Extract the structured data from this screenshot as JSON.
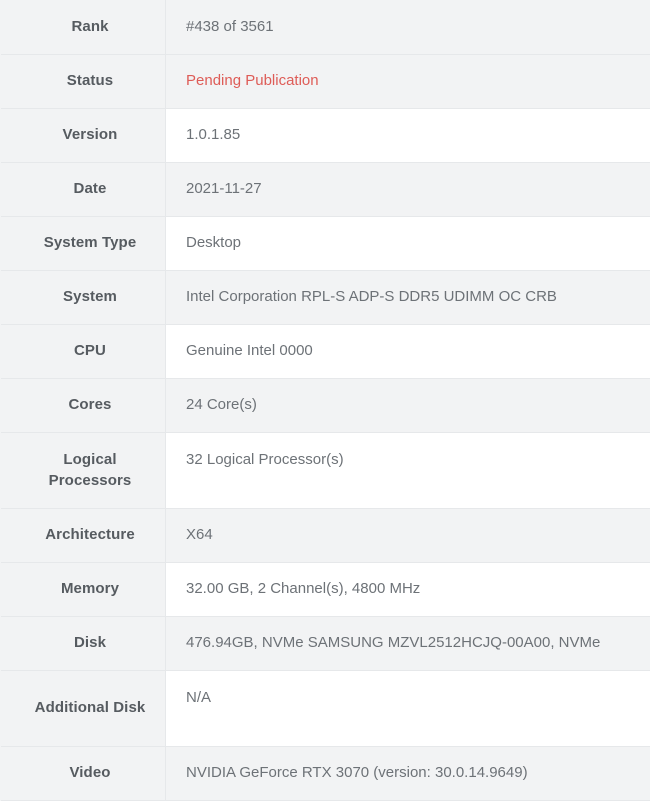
{
  "table": {
    "accent_color": "#de5c57",
    "label_color": "#565b60",
    "value_color": "#6d7277",
    "stripe_color": "#f2f3f4",
    "border_color": "#e6e8ea",
    "rows": [
      {
        "label": "Rank",
        "value": "#438 of 3561"
      },
      {
        "label": "Status",
        "value": "Pending Publication"
      },
      {
        "label": "Version",
        "value": "1.0.1.85"
      },
      {
        "label": "Date",
        "value": "2021-11-27"
      },
      {
        "label": "System Type",
        "value": "Desktop"
      },
      {
        "label": "System",
        "value": "Intel Corporation RPL-S ADP-S DDR5 UDIMM OC CRB"
      },
      {
        "label": "CPU",
        "value": "Genuine Intel 0000"
      },
      {
        "label": "Cores",
        "value": "24 Core(s)"
      },
      {
        "label": "Logical Processors",
        "value": "32 Logical Processor(s)"
      },
      {
        "label": "Architecture",
        "value": "X64"
      },
      {
        "label": "Memory",
        "value": "32.00 GB, 2 Channel(s), 4800 MHz"
      },
      {
        "label": "Disk",
        "value": "476.94GB, NVMe SAMSUNG MZVL2512HCJQ-00A00, NVMe"
      },
      {
        "label": "Additional Disk",
        "value": "N/A"
      },
      {
        "label": "Video",
        "value": "NVIDIA GeForce RTX 3070 (version: 30.0.14.9649)"
      }
    ]
  }
}
